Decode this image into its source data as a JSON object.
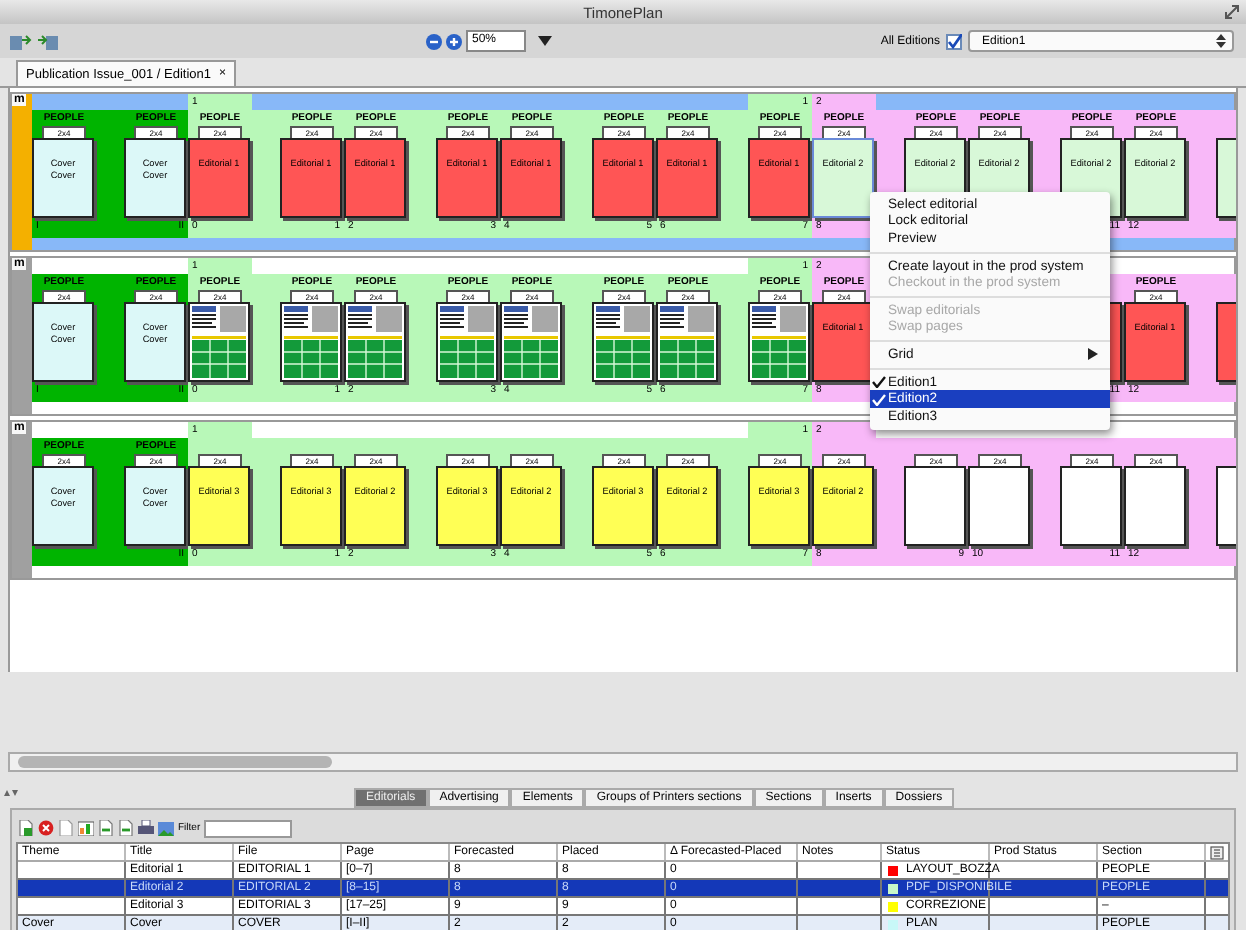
{
  "window": {
    "title": "TimonePlan"
  },
  "toolbar": {
    "zoom": "50%",
    "all_editions": {
      "label": "All Editions",
      "checked": true
    },
    "edition": "Edition1"
  },
  "tabs": [
    {
      "label": "Publication Issue_001 / Edition1",
      "close": "×",
      "selected": true
    }
  ],
  "editions": [
    {
      "marker": "m",
      "selected": true,
      "bands": [
        {
          "color": "#00b400",
          "pages": [
            {
              "kind": "cover",
              "section": "PEOPLE",
              "grid": "2x4",
              "lines": [
                "Cover",
                "Cover"
              ],
              "color": "#dcf8f8",
              "number": "I",
              "selected": false
            },
            {
              "kind": "cover",
              "section": "PEOPLE",
              "grid": "2x4",
              "lines": [
                "Cover",
                "Cover"
              ],
              "color": "#dcf8f8",
              "number": "II",
              "selected": false
            }
          ]
        },
        {
          "color": "#b8f8b8",
          "pages": [
            {
              "kind": "editorial",
              "flag": "1",
              "section": "PEOPLE",
              "grid": "2x4",
              "lines": [
                "Editorial 1"
              ],
              "color": "#ff5555",
              "number": "0",
              "selected": false
            },
            {
              "kind": "editorial",
              "section": "PEOPLE",
              "grid": "2x4",
              "lines": [
                "Editorial 1"
              ],
              "color": "#ff5555",
              "number": "1",
              "selected": false
            },
            {
              "kind": "editorial",
              "section": "PEOPLE",
              "grid": "2x4",
              "lines": [
                "Editorial 1"
              ],
              "color": "#ff5555",
              "number": "2",
              "selected": false
            },
            {
              "kind": "editorial",
              "section": "PEOPLE",
              "grid": "2x4",
              "lines": [
                "Editorial 1"
              ],
              "color": "#ff5555",
              "number": "3",
              "selected": false
            },
            {
              "kind": "editorial",
              "section": "PEOPLE",
              "grid": "2x4",
              "lines": [
                "Editorial 1"
              ],
              "color": "#ff5555",
              "number": "4",
              "selected": false
            },
            {
              "kind": "editorial",
              "section": "PEOPLE",
              "grid": "2x4",
              "lines": [
                "Editorial 1"
              ],
              "color": "#ff5555",
              "number": "5",
              "selected": false
            },
            {
              "kind": "editorial",
              "section": "PEOPLE",
              "grid": "2x4",
              "lines": [
                "Editorial 1"
              ],
              "color": "#ff5555",
              "number": "6",
              "selected": false
            },
            {
              "kind": "editorial",
              "flag": "1",
              "section": "PEOPLE",
              "grid": "2x4",
              "lines": [
                "Editorial 1"
              ],
              "color": "#ff5555",
              "number": "7",
              "selected": false
            }
          ]
        },
        {
          "color": "#f8b8f8",
          "pages": [
            {
              "kind": "editorial",
              "flag": "2",
              "section": "PEOPLE",
              "grid": "2x4",
              "lines": [
                "Editorial 2"
              ],
              "color": "#d8f8d8",
              "number": "8",
              "selected": true
            },
            {
              "kind": "editorial",
              "section": "PEOPLE",
              "grid": "2x4",
              "lines": [
                "Editorial 2"
              ],
              "color": "#d8f8d8",
              "selected": false
            },
            {
              "kind": "editorial",
              "section": "PEOPLE",
              "grid": "2x4",
              "lines": [
                "Editorial 2"
              ],
              "color": "#d8f8d8",
              "selected": false
            },
            {
              "kind": "editorial",
              "section": "PEOPLE",
              "grid": "2x4",
              "lines": [
                "Editorial 2"
              ],
              "color": "#d8f8d8",
              "number": "11",
              "selected": false
            },
            {
              "kind": "editorial",
              "section": "PEOPLE",
              "grid": "2x4",
              "lines": [
                "Editorial 2"
              ],
              "color": "#d8f8d8",
              "number": "12",
              "selected": false
            },
            {
              "kind": "editorial",
              "color": "#d8f8d8",
              "selected": false
            }
          ]
        }
      ]
    },
    {
      "marker": "m",
      "selected": false,
      "bands": [
        {
          "color": "#00b400",
          "pages": [
            {
              "kind": "cover",
              "section": "PEOPLE",
              "grid": "2x4",
              "lines": [
                "Cover",
                "Cover"
              ],
              "color": "#dcf8f8",
              "number": "I",
              "selected": false
            },
            {
              "kind": "cover",
              "section": "PEOPLE",
              "grid": "2x4",
              "lines": [
                "Cover",
                "Cover"
              ],
              "color": "#dcf8f8",
              "number": "II",
              "selected": false
            }
          ]
        },
        {
          "color": "#b8f8b8",
          "pages": [
            {
              "kind": "layout",
              "flag": "1",
              "section": "PEOPLE",
              "grid": "2x4",
              "number": "0",
              "selected": false
            },
            {
              "kind": "layout",
              "section": "PEOPLE",
              "grid": "2x4",
              "number": "1",
              "selected": false
            },
            {
              "kind": "layout",
              "section": "PEOPLE",
              "grid": "2x4",
              "number": "2",
              "selected": false
            },
            {
              "kind": "layout",
              "section": "PEOPLE",
              "grid": "2x4",
              "number": "3",
              "selected": false
            },
            {
              "kind": "layout",
              "section": "PEOPLE",
              "grid": "2x4",
              "number": "4",
              "selected": false
            },
            {
              "kind": "layout",
              "section": "PEOPLE",
              "grid": "2x4",
              "number": "5",
              "selected": false
            },
            {
              "kind": "layout",
              "section": "PEOPLE",
              "grid": "2x4",
              "number": "6",
              "selected": false
            },
            {
              "kind": "layout",
              "flag": "1",
              "section": "PEOPLE",
              "grid": "2x4",
              "number": "7",
              "selected": false
            }
          ]
        },
        {
          "color": "#f8b8f8",
          "pages": [
            {
              "kind": "editorial",
              "flag": "2",
              "section": "PEOPLE",
              "grid": "2x4",
              "lines": [
                "Editorial 1"
              ],
              "color": "#ff5555",
              "number": "8",
              "selected": false
            },
            {
              "kind": "covered"
            },
            {
              "kind": "covered"
            },
            {
              "kind": "editorial",
              "color": "#ff5555",
              "number": "11",
              "selected": false
            },
            {
              "kind": "editorial",
              "section": "PEOPLE",
              "grid": "2x4",
              "lines": [
                "Editorial 1"
              ],
              "color": "#ff5555",
              "number": "12",
              "selected": false
            },
            {
              "kind": "editorial",
              "color": "#ff5555",
              "selected": false
            }
          ]
        }
      ]
    },
    {
      "marker": "m",
      "selected": false,
      "bands": [
        {
          "color": "#00b400",
          "pages": [
            {
              "kind": "cover",
              "section": "PEOPLE",
              "grid": "2x4",
              "lines": [
                "Cover",
                "Cover"
              ],
              "color": "#dcf8f8",
              "selected": false
            },
            {
              "kind": "cover",
              "section": "PEOPLE",
              "grid": "2x4",
              "lines": [
                "Cover",
                "Cover"
              ],
              "color": "#dcf8f8",
              "number": "II",
              "selected": false
            }
          ]
        },
        {
          "color": "#b8f8b8",
          "pages": [
            {
              "kind": "editorial",
              "flag": "1",
              "grid": "2x4",
              "lines": [
                "Editorial 3"
              ],
              "color": "#ffff55",
              "number": "0",
              "selected": false
            },
            {
              "kind": "editorial",
              "grid": "2x4",
              "lines": [
                "Editorial 3"
              ],
              "color": "#ffff55",
              "number": "1",
              "selected": false
            },
            {
              "kind": "editorial",
              "grid": "2x4",
              "lines": [
                "Editorial 2"
              ],
              "color": "#ffff55",
              "number": "2",
              "selected": false
            },
            {
              "kind": "editorial",
              "grid": "2x4",
              "lines": [
                "Editorial 3"
              ],
              "color": "#ffff55",
              "number": "3",
              "selected": false
            },
            {
              "kind": "editorial",
              "grid": "2x4",
              "lines": [
                "Editorial 2"
              ],
              "color": "#ffff55",
              "number": "4",
              "selected": false
            },
            {
              "kind": "editorial",
              "grid": "2x4",
              "lines": [
                "Editorial 3"
              ],
              "color": "#ffff55",
              "number": "5",
              "selected": false
            },
            {
              "kind": "editorial",
              "grid": "2x4",
              "lines": [
                "Editorial 2"
              ],
              "color": "#ffff55",
              "number": "6",
              "selected": false
            },
            {
              "kind": "editorial",
              "flag": "1",
              "grid": "2x4",
              "lines": [
                "Editorial 3"
              ],
              "color": "#ffff55",
              "number": "7",
              "selected": false
            }
          ]
        },
        {
          "color": "#f8b8f8",
          "pages": [
            {
              "kind": "editorial",
              "flag": "2",
              "grid": "2x4",
              "lines": [
                "Editorial 2"
              ],
              "color": "#ffff55",
              "number": "8",
              "selected": false
            },
            {
              "kind": "blank",
              "grid": "2x4",
              "number": "9",
              "selected": false
            },
            {
              "kind": "blank",
              "grid": "2x4",
              "number": "10",
              "selected": false
            },
            {
              "kind": "blank",
              "grid": "2x4",
              "number": "11",
              "selected": false
            },
            {
              "kind": "blank",
              "grid": "2x4",
              "number": "12",
              "selected": false
            },
            {
              "kind": "blank",
              "selected": false
            }
          ]
        }
      ]
    }
  ],
  "context_menu": {
    "items": [
      {
        "kind": "item",
        "label": "Select editorial",
        "disabled": false,
        "checked": false,
        "selected": false
      },
      {
        "kind": "item",
        "label": "Lock editorial",
        "disabled": false,
        "checked": false,
        "selected": false
      },
      {
        "kind": "item",
        "label": "Preview",
        "disabled": false,
        "checked": false,
        "selected": false
      },
      {
        "kind": "separator"
      },
      {
        "kind": "item",
        "label": "Create layout in the prod system",
        "disabled": false,
        "checked": false,
        "selected": false
      },
      {
        "kind": "item",
        "label": "Checkout in the prod system",
        "disabled": true,
        "checked": false,
        "selected": false
      },
      {
        "kind": "separator"
      },
      {
        "kind": "item",
        "label": "Swap editorials",
        "disabled": true,
        "checked": false,
        "selected": false
      },
      {
        "kind": "item",
        "label": "Swap pages",
        "disabled": true,
        "checked": false,
        "selected": false
      },
      {
        "kind": "separator"
      },
      {
        "kind": "submenu",
        "label": "Grid",
        "disabled": false,
        "checked": false,
        "selected": false
      },
      {
        "kind": "separator"
      },
      {
        "kind": "item",
        "label": "Edition1",
        "disabled": false,
        "checked": true,
        "selected": false
      },
      {
        "kind": "item",
        "label": "Edition2",
        "disabled": false,
        "checked": true,
        "selected": true
      },
      {
        "kind": "item",
        "label": "Edition3",
        "disabled": false,
        "checked": false,
        "selected": false
      }
    ]
  },
  "panel": {
    "tabs": [
      {
        "label": "Editorials",
        "selected": true
      },
      {
        "label": "Advertising",
        "selected": false
      },
      {
        "label": "Elements",
        "selected": false
      },
      {
        "label": "Groups of Printers sections",
        "selected": false
      },
      {
        "label": "Sections",
        "selected": false
      },
      {
        "label": "Inserts",
        "selected": false
      },
      {
        "label": "Dossiers",
        "selected": false
      }
    ],
    "filter": {
      "label": "Filter"
    },
    "table": {
      "columns": [
        "Theme",
        "Title",
        "File",
        "Page",
        "Forecasted",
        "Placed",
        "Δ Forecasted-Placed",
        "Notes",
        "Status",
        "Prod Status",
        "Section"
      ],
      "rows": [
        {
          "title": "Editorial 1",
          "file": "EDITORIAL 1",
          "page": "[0–7]",
          "forecasted": "8",
          "placed": "8",
          "delta": "0",
          "status": {
            "label": "LAYOUT_BOZZA",
            "color": "#ff0000"
          },
          "section": "PEOPLE",
          "selected": false
        },
        {
          "title": "Editorial 2",
          "file": "EDITORIAL 2",
          "page": "[8–15]",
          "forecasted": "8",
          "placed": "8",
          "delta": "0",
          "status": {
            "label": "PDF_DISPONIBILE",
            "color": "#c8f8c8"
          },
          "section": "PEOPLE",
          "selected": true
        },
        {
          "title": "Editorial 3",
          "file": "EDITORIAL 3",
          "page": "[17–25]",
          "forecasted": "9",
          "placed": "9",
          "delta": "0",
          "status": {
            "label": "CORREZIONE",
            "color": "#ffff00"
          },
          "section": "–",
          "selected": false
        },
        {
          "theme": "Cover",
          "title": "Cover",
          "file": "COVER",
          "page": "[I–II]",
          "forecasted": "2",
          "placed": "2",
          "delta": "0",
          "status": {
            "label": "PLAN",
            "color": "#c8f8f8"
          },
          "section": "PEOPLE",
          "selected": false
        }
      ]
    }
  }
}
